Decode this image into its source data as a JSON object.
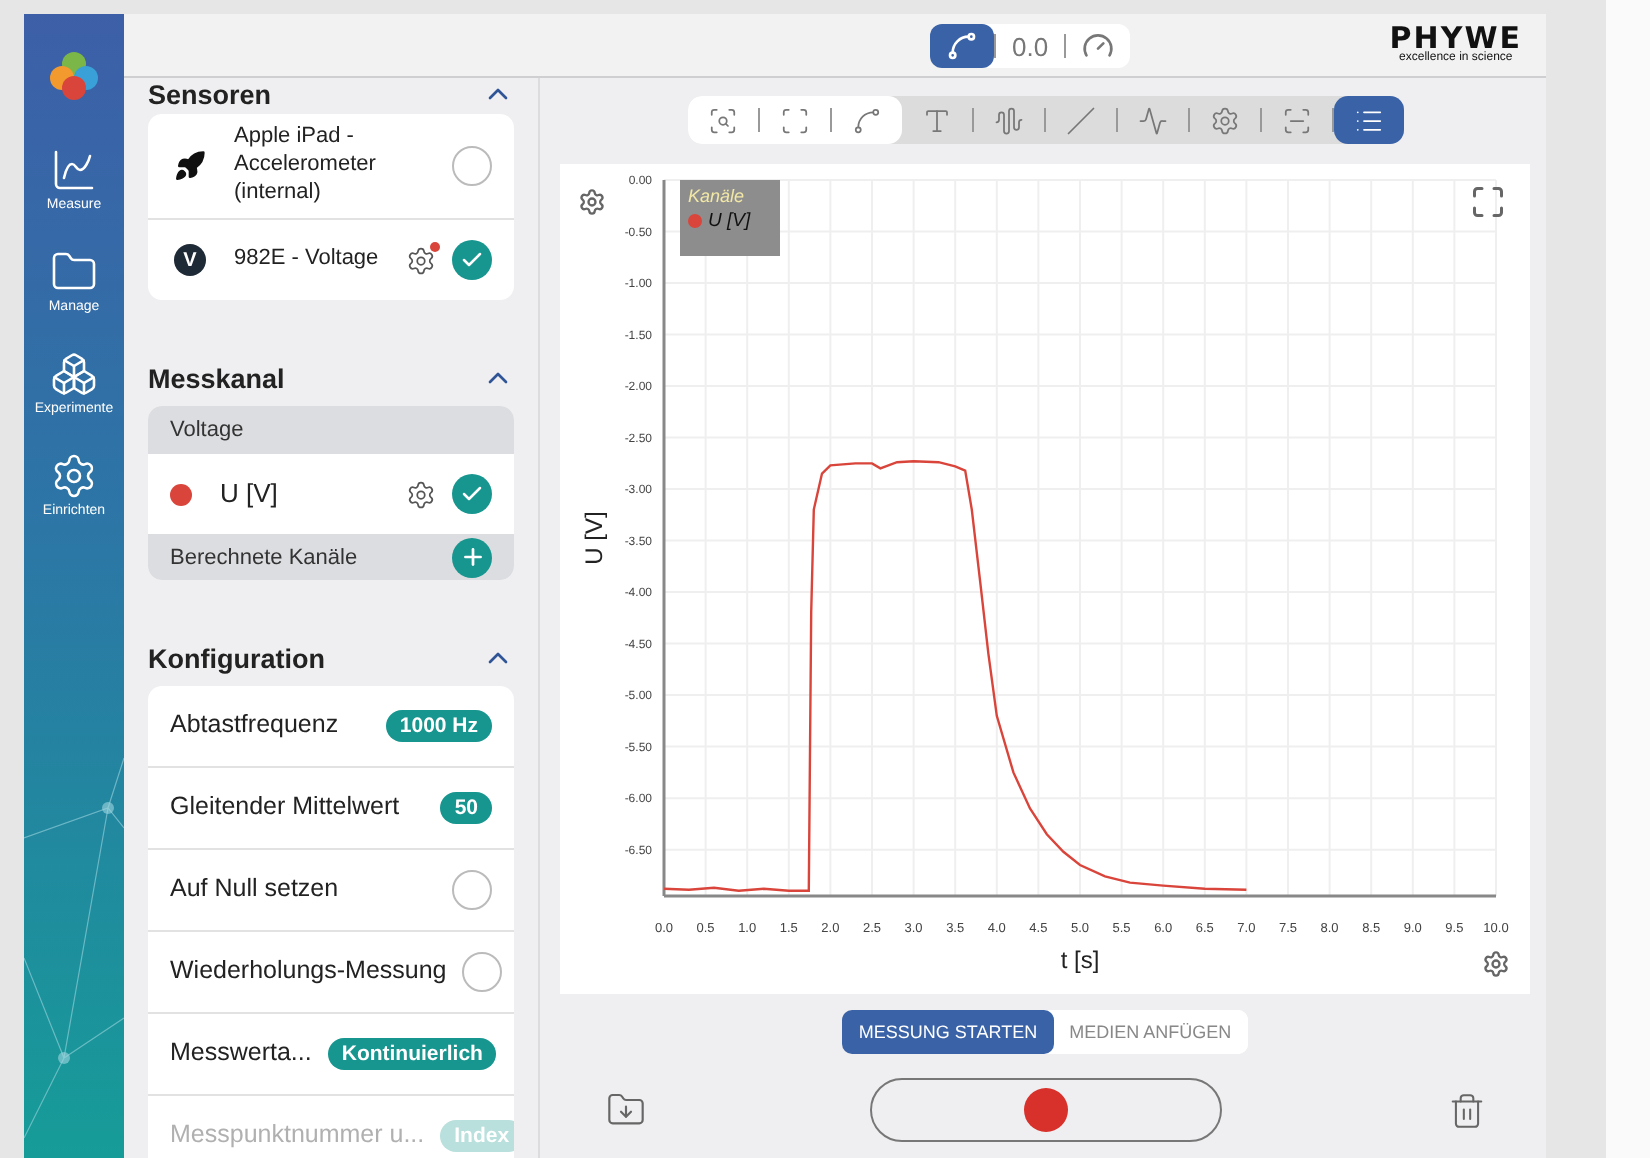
{
  "nav": {
    "items": [
      {
        "label": "Measure"
      },
      {
        "label": "Manage"
      },
      {
        "label": "Experimente"
      },
      {
        "label": "Einrichten"
      }
    ]
  },
  "header": {
    "mode_toggle": [
      {
        "kind": "graph",
        "selected": true
      },
      {
        "kind": "value",
        "label": "0.0",
        "selected": false
      },
      {
        "kind": "gauge",
        "selected": false
      }
    ],
    "logo": {
      "name": "PHYWE",
      "tagline": "excellence in science"
    }
  },
  "sensors": {
    "title": "Sensoren",
    "expanded": true,
    "items": [
      {
        "kind": "internal",
        "name": "Apple iPad - Accelerometer (internal)",
        "checked": false,
        "settings": false
      },
      {
        "kind": "device",
        "badge": "V",
        "name": "982E - Voltage",
        "checked": true,
        "settings": true,
        "notification": true
      }
    ]
  },
  "channel": {
    "title": "Messkanal",
    "expanded": true,
    "group": "Voltage",
    "items": [
      {
        "name": "U [V]",
        "color": "#d9453b",
        "checked": true
      }
    ],
    "computed": {
      "label": "Berechnete Kanäle"
    }
  },
  "config": {
    "title": "Konfiguration",
    "expanded": true,
    "items": [
      {
        "label": "Abtastfrequenz",
        "kind": "badge",
        "value": "1000 Hz",
        "disabled": false
      },
      {
        "label": "Gleitender Mittelwert",
        "kind": "badge",
        "value": "50",
        "disabled": false
      },
      {
        "label": "Auf Null setzen",
        "kind": "toggle",
        "checked": false,
        "disabled": false
      },
      {
        "label": "Wiederholungs-Messung",
        "kind": "toggle",
        "checked": false,
        "disabled": false
      },
      {
        "label": "Messwerta...",
        "kind": "badge",
        "value": "Kontinuierlich",
        "disabled": false
      },
      {
        "label": "Messpunktnummer u...",
        "kind": "badge",
        "value": "Index",
        "disabled": true
      }
    ]
  },
  "toolbar": {
    "primary": [
      {
        "kind": "zoom",
        "selected": false
      },
      {
        "kind": "fit",
        "selected": false
      },
      {
        "kind": "line",
        "selected": false
      }
    ],
    "secondary": [
      {
        "kind": "text",
        "selected": false
      },
      {
        "kind": "smooth",
        "selected": false
      },
      {
        "kind": "tangent",
        "selected": false
      },
      {
        "kind": "fit-curve",
        "selected": false
      },
      {
        "kind": "settings",
        "selected": false
      },
      {
        "kind": "scan",
        "selected": false
      },
      {
        "kind": "list",
        "selected": true
      }
    ]
  },
  "chart": {
    "legend": {
      "title": "Kanäle"
    },
    "chart_data": {
      "type": "line",
      "grid": true,
      "xlabel": "t [s]",
      "ylabel": "U [V]",
      "x": [
        0,
        0.3,
        0.6,
        0.9,
        1.2,
        1.5,
        1.74,
        1.77,
        1.8,
        1.9,
        2.0,
        2.3,
        2.5,
        2.6,
        2.8,
        3.0,
        3.3,
        3.5,
        3.62,
        3.7,
        3.8,
        3.9,
        4.0,
        4.2,
        4.4,
        4.6,
        4.8,
        5.0,
        5.3,
        5.6,
        6.0,
        6.5,
        7.0
      ],
      "series": [
        {
          "name": "U [V]",
          "color": "#d9453b",
          "values": [
            -6.88,
            -6.89,
            -6.87,
            -6.9,
            -6.88,
            -6.9,
            -6.9,
            -4.2,
            -3.2,
            -2.85,
            -2.77,
            -2.75,
            -2.75,
            -2.8,
            -2.74,
            -2.73,
            -2.74,
            -2.78,
            -2.82,
            -3.2,
            -3.9,
            -4.6,
            -5.2,
            -5.75,
            -6.1,
            -6.35,
            -6.52,
            -6.65,
            -6.76,
            -6.82,
            -6.85,
            -6.88,
            -6.89
          ]
        }
      ],
      "xlim": [
        0,
        10
      ],
      "ylim": [
        -6.95,
        0
      ],
      "xticks": [
        {
          "value": 0,
          "label": "0.0"
        },
        {
          "value": 0.5,
          "label": "0.5"
        },
        {
          "value": 1,
          "label": "1.0"
        },
        {
          "value": 1.5,
          "label": "1.5"
        },
        {
          "value": 2,
          "label": "2.0"
        },
        {
          "value": 2.5,
          "label": "2.5"
        },
        {
          "value": 3,
          "label": "3.0"
        },
        {
          "value": 3.5,
          "label": "3.5"
        },
        {
          "value": 4,
          "label": "4.0"
        },
        {
          "value": 4.5,
          "label": "4.5"
        },
        {
          "value": 5,
          "label": "5.0"
        },
        {
          "value": 5.5,
          "label": "5.5"
        },
        {
          "value": 6,
          "label": "6.0"
        },
        {
          "value": 6.5,
          "label": "6.5"
        },
        {
          "value": 7,
          "label": "7.0"
        },
        {
          "value": 7.5,
          "label": "7.5"
        },
        {
          "value": 8,
          "label": "8.0"
        },
        {
          "value": 8.5,
          "label": "8.5"
        },
        {
          "value": 9,
          "label": "9.0"
        },
        {
          "value": 9.5,
          "label": "9.5"
        },
        {
          "value": 10,
          "label": "10.0"
        }
      ],
      "yticks": [
        {
          "value": 0,
          "label": "0.00"
        },
        {
          "value": -0.5,
          "label": "-0.50"
        },
        {
          "value": -1,
          "label": "-1.00"
        },
        {
          "value": -1.5,
          "label": "-1.50"
        },
        {
          "value": -2,
          "label": "-2.00"
        },
        {
          "value": -2.5,
          "label": "-2.50"
        },
        {
          "value": -3,
          "label": "-3.00"
        },
        {
          "value": -3.5,
          "label": "-3.50"
        },
        {
          "value": -4,
          "label": "-4.00"
        },
        {
          "value": -4.5,
          "label": "-4.50"
        },
        {
          "value": -5,
          "label": "-5.00"
        },
        {
          "value": -5.5,
          "label": "-5.50"
        },
        {
          "value": -6,
          "label": "-6.00"
        },
        {
          "value": -6.5,
          "label": "-6.50"
        }
      ]
    }
  },
  "actions": {
    "tabs": [
      {
        "label": "MESSUNG STARTEN",
        "selected": true
      },
      {
        "label": "MEDIEN ANFÜGEN",
        "selected": false
      }
    ],
    "recording": false
  }
}
